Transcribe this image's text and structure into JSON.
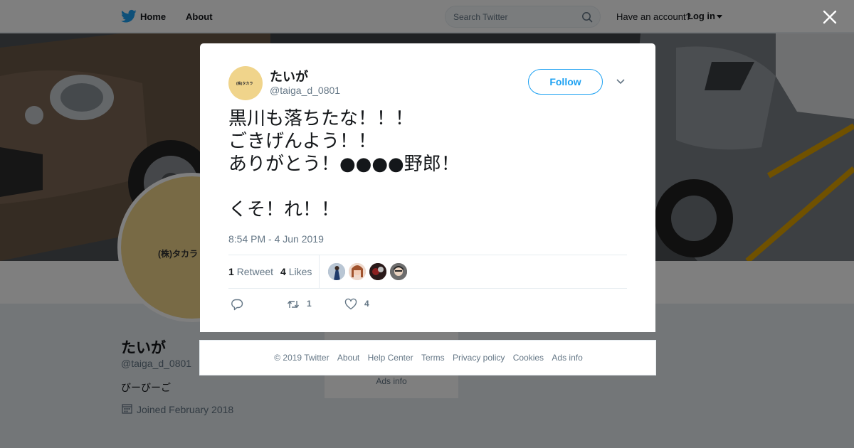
{
  "topbar": {
    "home_label": "Home",
    "about_label": "About",
    "search_placeholder": "Search Twitter",
    "account_prompt": "Have an account?",
    "login_label": "Log in"
  },
  "profile": {
    "avatar_text": "(株)タカラ",
    "name": "たいが",
    "handle": "@taiga_d_0801",
    "bio": "びーびーご",
    "joined": "Joined February 2018"
  },
  "sidebar": {
    "ads_info": "Ads info"
  },
  "tweet": {
    "author_name": "たいが",
    "author_handle": "@taiga_d_0801",
    "follow_label": "Follow",
    "text_lines": [
      "黒川も落ちたな！！！",
      "ごきげんよう！！",
      "ありがとう！●●●●野郎！",
      "",
      "くそ！れ！！"
    ],
    "timestamp": "8:54 PM - 4 Jun 2019",
    "retweets": {
      "count": "1",
      "label": "Retweet"
    },
    "likes": {
      "count": "4",
      "label": "Likes"
    },
    "liker_colors": [
      "#8a9bb0",
      "#d9b8a6",
      "#3a2020",
      "#5b5b5b"
    ],
    "actions": {
      "retweet_count": "1",
      "like_count": "4"
    }
  },
  "footer": {
    "links": [
      "© 2019 Twitter",
      "About",
      "Help Center",
      "Terms",
      "Privacy policy",
      "Cookies",
      "Ads info"
    ]
  },
  "colors": {
    "accent": "#1da1f2",
    "avatar_bg": "#f0d48b",
    "overlay": "rgba(0,0,0,0.5)"
  }
}
